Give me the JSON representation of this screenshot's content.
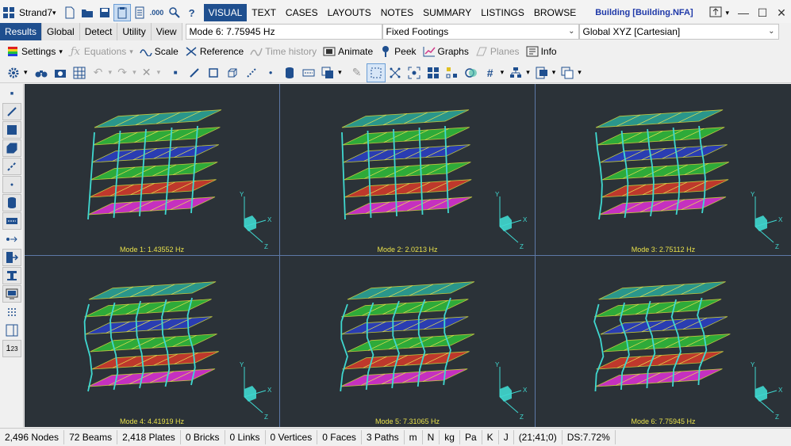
{
  "titlebar": {
    "app_name": "Strand7",
    "tabs": [
      "VISUAL",
      "TEXT",
      "CASES",
      "LAYOUTS",
      "NOTES",
      "SUMMARY",
      "LISTINGS",
      "BROWSE"
    ],
    "active_tab": "VISUAL",
    "window_title": "Building [Building.NFA]"
  },
  "subbar": {
    "tabs": [
      "Results",
      "Global",
      "Detect",
      "Utility",
      "View"
    ],
    "active_tab": "Results",
    "mode_combo": "Mode 6: 7.75945 Hz",
    "freedom_combo": "Fixed Footings",
    "coord_combo": "Global XYZ [Cartesian]"
  },
  "toolbar": {
    "settings_label": "Settings",
    "equations_label": "Equations",
    "scale_label": "Scale",
    "reference_label": "Reference",
    "time_history_label": "Time history",
    "animate_label": "Animate",
    "peek_label": "Peek",
    "graphs_label": "Graphs",
    "planes_label": "Planes",
    "info_label": "Info"
  },
  "panes": [
    {
      "label": "Mode 1: 1.43552 Hz"
    },
    {
      "label": "Mode 2: 2.0213 Hz"
    },
    {
      "label": "Mode 3: 2.75112 Hz"
    },
    {
      "label": "Mode 4: 4.41919 Hz"
    },
    {
      "label": "Mode 5: 7.31065 Hz"
    },
    {
      "label": "Mode 6: 7.75945 Hz"
    }
  ],
  "axes": {
    "x": "X",
    "y": "Y",
    "z": "Z"
  },
  "status": {
    "nodes": "2,496 Nodes",
    "beams": "72 Beams",
    "plates": "2,418 Plates",
    "bricks": "0 Bricks",
    "links": "0 Links",
    "vertices": "0 Vertices",
    "faces": "0 Faces",
    "paths": "3 Paths",
    "unit_length": "m",
    "unit_force": "N",
    "unit_mass": "kg",
    "unit_stress": "Pa",
    "unit_temp": "K",
    "unit_energy": "J",
    "coords": "(21;41;0)",
    "ds": "DS:7.72%"
  },
  "colors": {
    "accent": "#1f4f8f",
    "viewport_bg": "#2b3238",
    "mode_label": "#e8e04a",
    "floor_top": "#2aa89a",
    "floor_magenta": "#e030d8",
    "floor_blue": "#2a3fc8",
    "floor_green": "#2fbf3a",
    "floor_red": "#d83a2a",
    "column": "#3fd8d0"
  }
}
